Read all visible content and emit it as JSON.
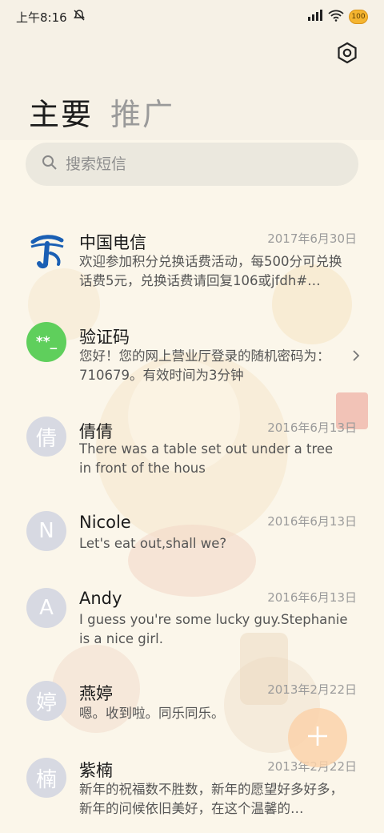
{
  "status": {
    "time": "上午8:16",
    "battery": "100"
  },
  "tabs": [
    {
      "label": "主要"
    },
    {
      "label": "推广"
    }
  ],
  "search": {
    "placeholder": "搜索短信"
  },
  "conversations": [
    {
      "name": "中国电信",
      "date": "2017年6月30日",
      "preview": "欢迎参加积分兑换话费活动，每500分可兑换话费5元，兑换话费请回复106或jfdh#…",
      "avatar": "telecom-logo"
    },
    {
      "name": "验证码",
      "date": "",
      "preview": "您好！您的网上营业厅登录的随机密码为：710679。有效时间为3分钟",
      "avatar_text": "**_",
      "avatar_color": "#5fcf5c"
    },
    {
      "name": "倩倩",
      "date": "2016年6月13日",
      "preview": "There was a table set out under a tree in front of the hous",
      "avatar_text": "倩"
    },
    {
      "name": "Nicole",
      "date": "2016年6月13日",
      "preview": "Let's eat out,shall we?",
      "avatar_text": "N"
    },
    {
      "name": "Andy",
      "date": "2016年6月13日",
      "preview": "I guess you're some lucky guy.Stephanie is a nice girl.",
      "avatar_text": "A"
    },
    {
      "name": "燕婷",
      "date": "2013年2月22日",
      "preview": "嗯。收到啦。同乐同乐。",
      "avatar_text": "婷"
    },
    {
      "name": "紫楠",
      "date": "2013年2月22日",
      "preview": "新年的祝福数不胜数，新年的愿望好多好多，新年的问候依旧美好，在这个温馨的…",
      "avatar_text": "楠"
    }
  ]
}
